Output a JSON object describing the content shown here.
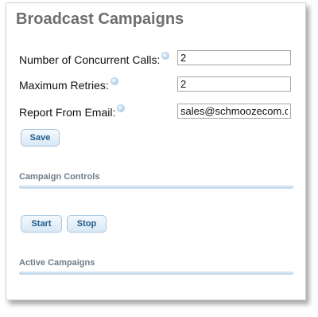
{
  "page": {
    "title": "Broadcast Campaigns"
  },
  "settings": {
    "concurrent_calls": {
      "label": "Number of Concurrent Calls:",
      "value": "2"
    },
    "max_retries": {
      "label": "Maximum Retries:",
      "value": "2"
    },
    "report_email": {
      "label": "Report From Email:",
      "value": "sales@schmoozecom.com"
    },
    "save_label": "Save"
  },
  "campaign_controls": {
    "title": "Campaign Controls",
    "start_label": "Start",
    "stop_label": "Stop"
  },
  "active_campaigns": {
    "title": "Active Campaigns"
  },
  "colors": {
    "title": "#6e6e6e",
    "button_text": "#1f5a8a",
    "section_title": "#6f7b87",
    "section_bar": "#b9d2e8"
  }
}
